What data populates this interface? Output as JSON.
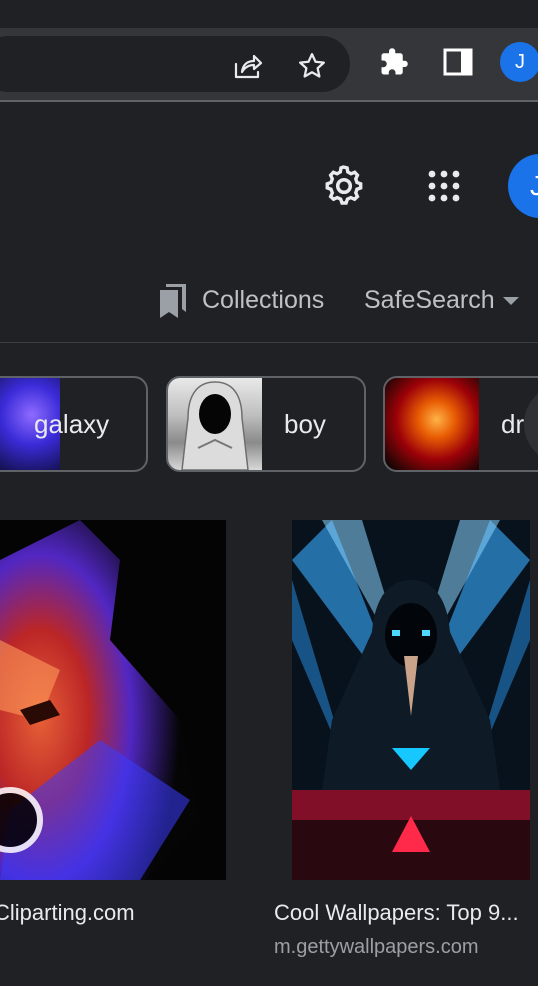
{
  "browser": {
    "profile_initial": "J",
    "icons": [
      "share-icon",
      "star-icon",
      "extensions-icon",
      "side-panel-icon"
    ]
  },
  "google": {
    "avatar_initial": "J",
    "settings_icon": "gear-icon",
    "apps_icon": "apps-grid-icon"
  },
  "tools": {
    "collections_label": "Collections",
    "safesearch_label": "SafeSearch"
  },
  "chips": [
    {
      "label": "galaxy"
    },
    {
      "label": "boy"
    },
    {
      "label": "dr"
    }
  ],
  "results": [
    {
      "title": "Cliparting.com",
      "source": ""
    },
    {
      "title": "Cool Wallpapers: Top 9...",
      "source": "m.gettywallpapers.com"
    }
  ],
  "colors": {
    "background": "#202124",
    "toolbar": "#35363a",
    "accent_blue": "#1a73e8",
    "chip_border": "#5f6368"
  }
}
